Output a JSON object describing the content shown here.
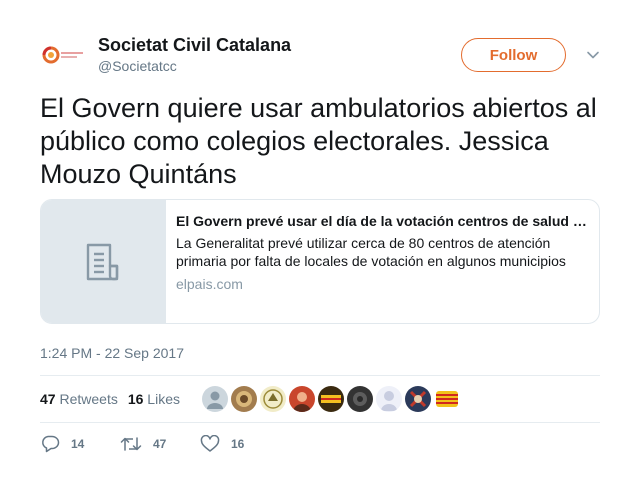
{
  "user": {
    "name": "Societat Civil Catalana",
    "handle": "@Societatcc",
    "avatar_icon": "scc-logo-icon"
  },
  "follow_label": "Follow",
  "tweet": {
    "text": "El Govern quiere usar ambulatorios abiertos al público como colegios electorales. Jessica Mouzo Quintáns"
  },
  "card": {
    "thumb_icon": "document-icon",
    "title": "El Govern prevé usar el día de la votación centros de salud abiertos al público",
    "description": "La Generalitat prevé utilizar cerca de 80 centros de atención primaria por falta de locales de votación en algunos municipios",
    "domain": "elpais.com"
  },
  "timestamp": "1:24 PM - 22 Sep 2017",
  "stats": {
    "retweets_count": "47",
    "retweets_label": "Retweets",
    "likes_count": "16",
    "likes_label": "Likes"
  },
  "actions": {
    "reply_count": "14",
    "retweet_count": "47",
    "like_count": "16"
  },
  "colors": {
    "accent": "#e36c2e",
    "secondary_text": "#657786",
    "border": "#e1e8ed"
  }
}
